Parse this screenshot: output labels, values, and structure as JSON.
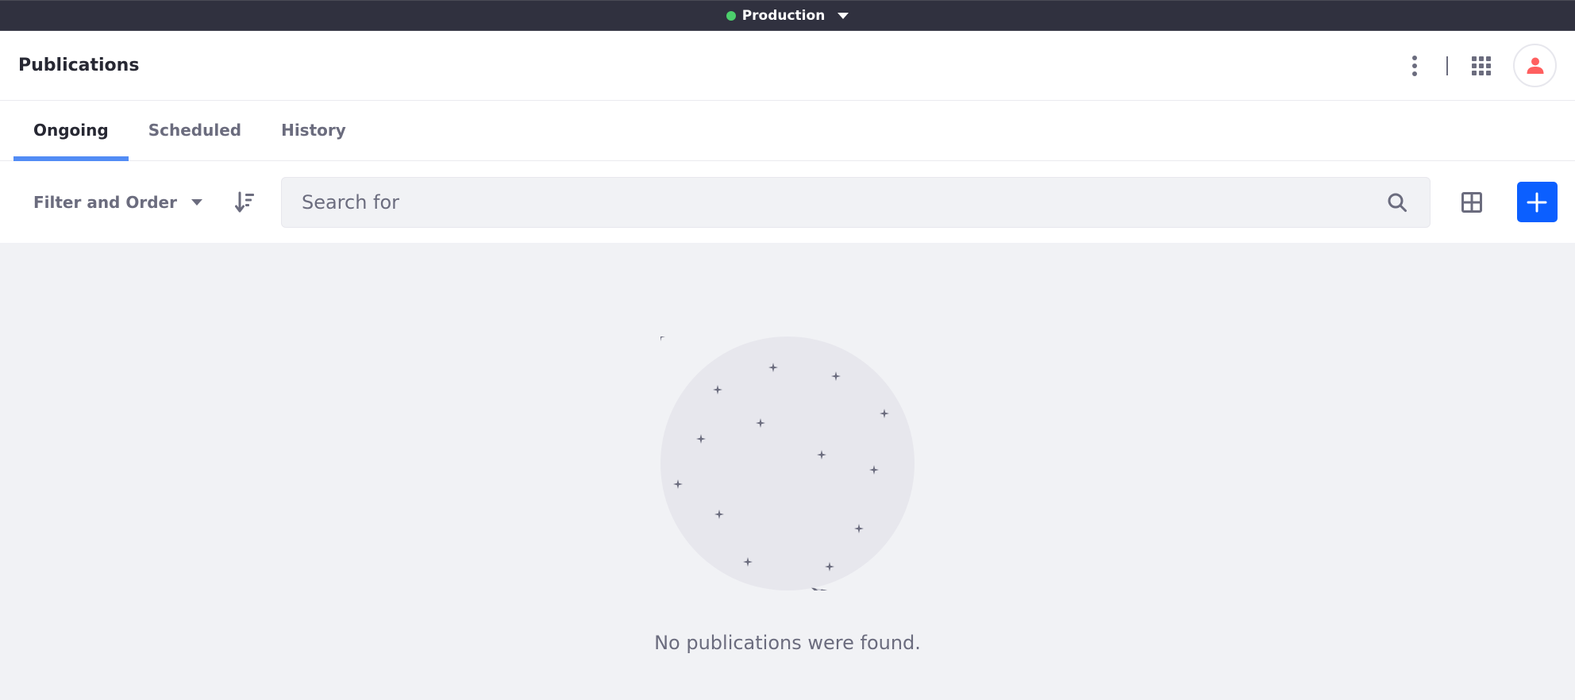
{
  "topbar": {
    "environment_label": "Production",
    "environment_status_color": "#4ccf6c"
  },
  "header": {
    "title": "Publications",
    "icons": [
      "kebab-menu-icon",
      "apps-grid-icon",
      "user-avatar-icon"
    ]
  },
  "tabs": [
    {
      "label": "Ongoing",
      "active": true
    },
    {
      "label": "Scheduled",
      "active": false
    },
    {
      "label": "History",
      "active": false
    }
  ],
  "toolbar": {
    "filter_label": "Filter and Order",
    "search_placeholder": "Search for",
    "search_value": "",
    "icons": [
      "sort-order-icon",
      "search-icon",
      "card-view-icon",
      "plus-icon"
    ]
  },
  "empty_state": {
    "message": "No publications were found.",
    "illustration": "satellite-in-space"
  },
  "colors": {
    "accent": "#0b5fff",
    "tab_indicator": "#528cf5",
    "topbar_bg": "#30313f",
    "avatar_icon": "#ff5f5f"
  }
}
